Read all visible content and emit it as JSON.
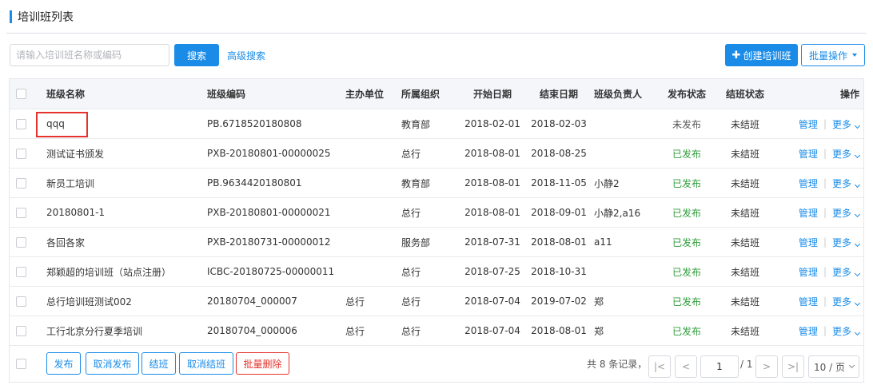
{
  "page": {
    "title": "培训班列表"
  },
  "toolbar": {
    "search_placeholder": "请输入培训班名称或编码",
    "search_value": "",
    "search_label": "搜索",
    "advanced_label": "高级搜索",
    "create_label": "创建培训班",
    "batch_label": "批量操作"
  },
  "table": {
    "headers": {
      "name": "班级名称",
      "code": "班级编码",
      "host": "主办单位",
      "org": "所属组织",
      "start": "开始日期",
      "end": "结束日期",
      "manager": "班级负责人",
      "publish": "发布状态",
      "class_status": "结班状态",
      "actions": "操作"
    },
    "action_manage": "管理",
    "action_more": "更多",
    "rows": [
      {
        "name": "qqq",
        "code": "PB.6718520180808",
        "host": "",
        "org": "教育部",
        "start": "2018-02-01",
        "end": "2018-02-03",
        "manager": "",
        "publish": "未发布",
        "class_status": "未结班"
      },
      {
        "name": "测试证书颁发",
        "code": "PXB-20180801-00000025",
        "host": "",
        "org": "总行",
        "start": "2018-08-01",
        "end": "2018-08-25",
        "manager": "",
        "publish": "已发布",
        "class_status": "未结班"
      },
      {
        "name": "新员工培训",
        "code": "PB.9634420180801",
        "host": "",
        "org": "教育部",
        "start": "2018-08-01",
        "end": "2018-11-05",
        "manager": "小静2",
        "publish": "已发布",
        "class_status": "未结班"
      },
      {
        "name": "20180801-1",
        "code": "PXB-20180801-00000021",
        "host": "",
        "org": "总行",
        "start": "2018-08-01",
        "end": "2018-09-01",
        "manager": "小静2,a16",
        "publish": "已发布",
        "class_status": "未结班"
      },
      {
        "name": "各回各家",
        "code": "PXB-20180731-00000012",
        "host": "",
        "org": "服务部",
        "start": "2018-07-31",
        "end": "2018-08-01",
        "manager": "a11",
        "publish": "已发布",
        "class_status": "未结班"
      },
      {
        "name": "郑颖超的培训班（站点注册）",
        "code": "ICBC-20180725-00000011",
        "host": "",
        "org": "总行",
        "start": "2018-07-25",
        "end": "2018-10-31",
        "manager": "",
        "publish": "已发布",
        "class_status": "未结班"
      },
      {
        "name": "总行培训班测试002",
        "code": "20180704_000007",
        "host": "总行",
        "org": "总行",
        "start": "2018-07-04",
        "end": "2019-07-02",
        "manager": "郑",
        "publish": "已发布",
        "class_status": "未结班"
      },
      {
        "name": "工行北京分行夏季培训",
        "code": "20180704_000006",
        "host": "总行",
        "org": "总行",
        "start": "2018-07-04",
        "end": "2018-08-01",
        "manager": "郑",
        "publish": "已发布",
        "class_status": "未结班"
      }
    ]
  },
  "footer": {
    "publish": "发布",
    "unpublish": "取消发布",
    "close": "结班",
    "unclose": "取消结班",
    "batch_delete": "批量删除"
  },
  "pager": {
    "total_text": "共 8 条记录，",
    "first": "|<",
    "prev": "<",
    "current": "1",
    "total_pages": "/ 1",
    "next": ">",
    "last": ">|",
    "page_size": "10 / 页"
  },
  "colors": {
    "accent": "#1a8ce8",
    "published": "#2e9d3a",
    "danger": "#e5322d"
  }
}
